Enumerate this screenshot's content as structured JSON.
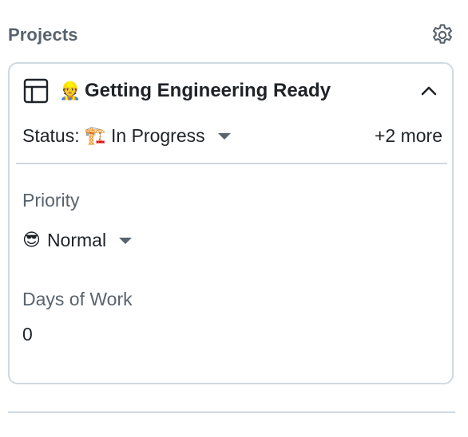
{
  "section": {
    "title": "Projects",
    "settings_icon": "gear-icon"
  },
  "project": {
    "icon": "table-icon",
    "title_emoji": "👷",
    "name": "Getting Engineering Ready",
    "collapse_icon": "chevron-up-icon",
    "status": {
      "label": "Status:",
      "emoji": "🏗️",
      "value": "In Progress"
    },
    "more_fields": "+2 more",
    "fields": {
      "priority": {
        "label": "Priority",
        "emoji": "😎",
        "value": "Normal"
      },
      "days_of_work": {
        "label": "Days of Work",
        "value": "0"
      }
    }
  },
  "colors": {
    "muted_text": "#59636e",
    "border": "#d1d9e0",
    "text": "#1f2328"
  }
}
